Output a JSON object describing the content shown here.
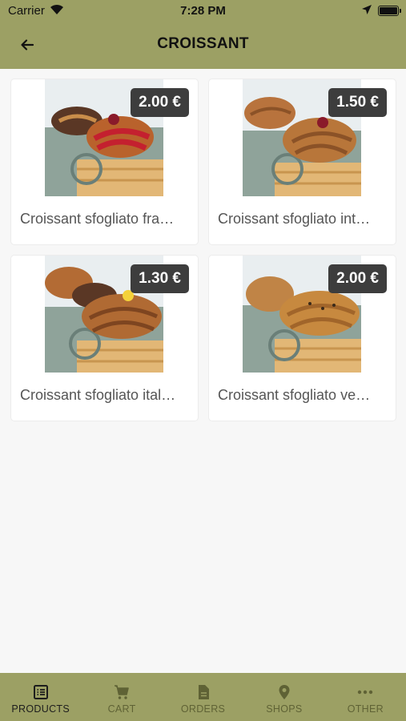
{
  "status_bar": {
    "carrier": "Carrier",
    "time": "7:28 PM"
  },
  "header": {
    "title": "CROISSANT",
    "back_icon": "arrow-left-icon"
  },
  "products": [
    {
      "price": "2.00 €",
      "name": "Croissant sfogliato fra…",
      "image": "croissant-photo-red-glaze"
    },
    {
      "price": "1.50 €",
      "name": "Croissant sfogliato int…",
      "image": "croissant-photo-wholegrain"
    },
    {
      "price": "1.30 €",
      "name": "Croissant sfogliato ital…",
      "image": "croissant-photo-classic"
    },
    {
      "price": "2.00 €",
      "name": "Croissant sfogliato ve…",
      "image": "croissant-photo-vegan"
    }
  ],
  "tabs": [
    {
      "label": "PRODUCTS",
      "icon": "list-icon",
      "active": true
    },
    {
      "label": "CART",
      "icon": "cart-icon",
      "active": false
    },
    {
      "label": "ORDERS",
      "icon": "document-icon",
      "active": false
    },
    {
      "label": "SHOPS",
      "icon": "location-pin-icon",
      "active": false
    },
    {
      "label": "OTHER",
      "icon": "more-dots-icon",
      "active": false
    }
  ],
  "colors": {
    "bar": "#9ca064",
    "price_badge": "#3d3d3d",
    "background": "#f7f7f7"
  }
}
